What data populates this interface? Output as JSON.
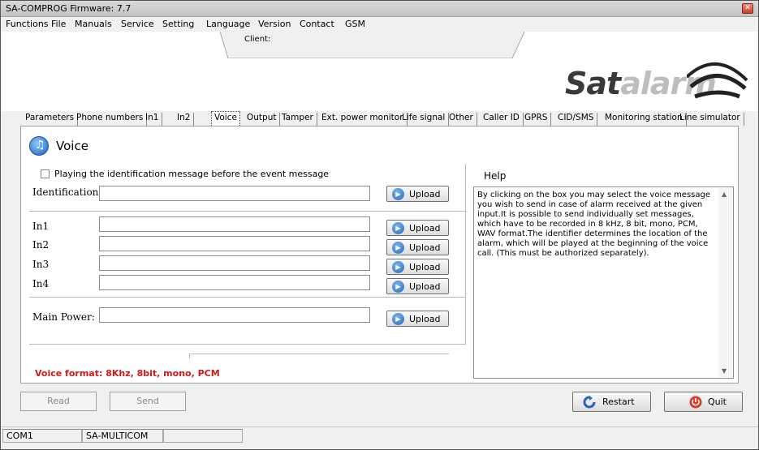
{
  "window": {
    "title": "SA-COMPROG Firmware: 7.7"
  },
  "menu": [
    "Functions",
    "File",
    "Manuals",
    "Service",
    "Setting",
    "Language",
    "Version",
    "Contact",
    "GSM"
  ],
  "header": {
    "client_label": "Client:",
    "logo_part1": "Sat",
    "logo_part2": "alarm"
  },
  "tabs": [
    "Parameters",
    "Phone numbers",
    "In1",
    "In2",
    "Voice",
    "Output",
    "Tamper",
    "Ext. power monitor",
    "Life signal",
    "Other",
    "Caller ID",
    "GPRS",
    "CID/SMS",
    "Monitoring station",
    "Line simulator"
  ],
  "active_tab": "Voice",
  "voice": {
    "title": "Voice",
    "checkbox_label": "Playing the identification message before the event message",
    "identification_label": "Identification",
    "inputs": [
      "In1",
      "In2",
      "In3",
      "In4"
    ],
    "main_power_label": "Main Power:",
    "upload_label": "Upload",
    "format_text": "Voice format: 8Khz, 8bit, mono, PCM"
  },
  "help": {
    "title": "Help",
    "text": "By clicking on the box you may select the voice message you wish to send in case of alarm received at the given input.It is possible to send individually set messages, which have to be recorded in 8 kHz, 8 bit, mono, PCM, WAV format.The identifier determines the location of the alarm, which will be played at the beginning of the voice call. (This must be authorized separately)."
  },
  "buttons": {
    "read": "Read",
    "send": "Send",
    "restart": "Restart",
    "quit": "Quit"
  },
  "status": {
    "port": "COM1",
    "device": "SA-MULTICOM"
  },
  "colors": {
    "format_text": "#d31818",
    "accent": "#2566b8"
  }
}
